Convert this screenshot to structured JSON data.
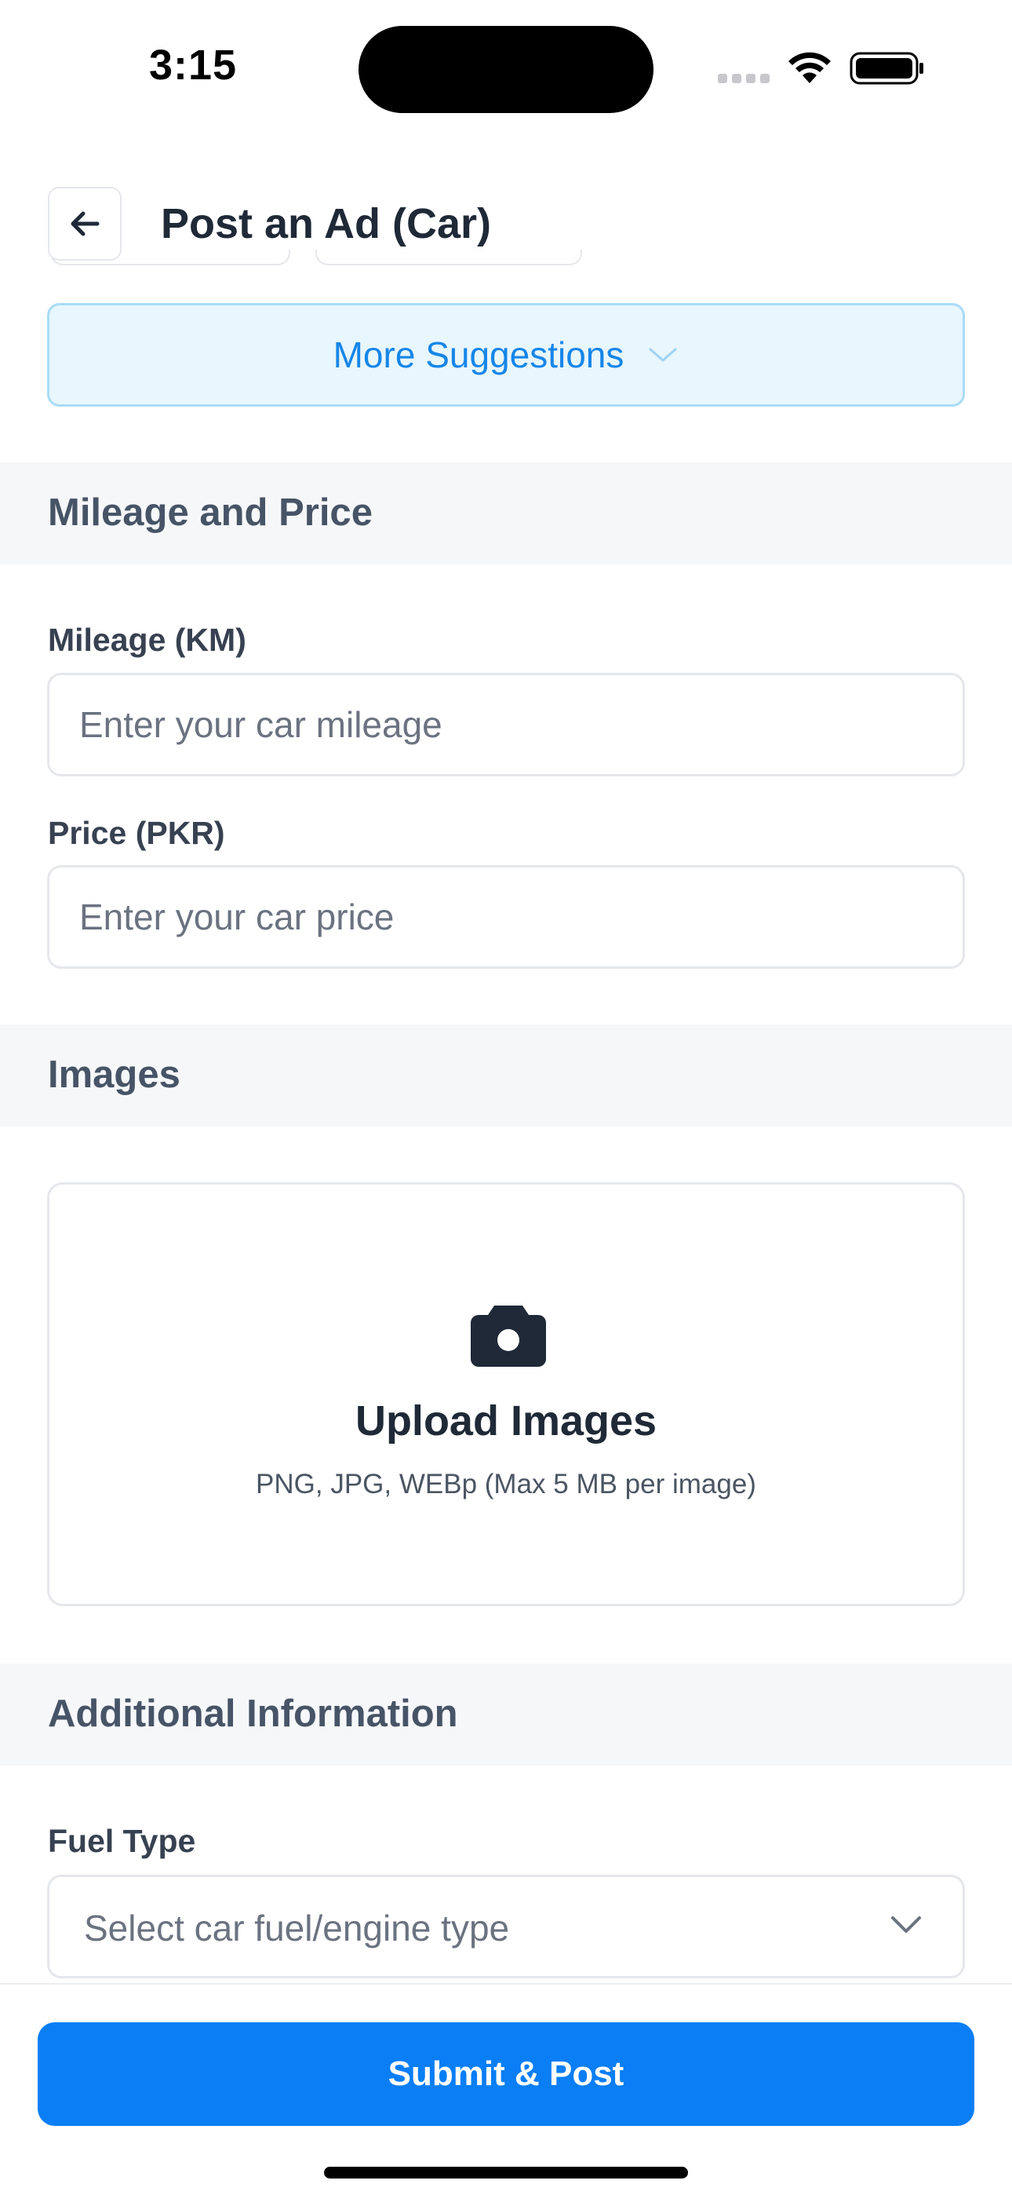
{
  "status_bar": {
    "time": "3:15"
  },
  "header": {
    "title": "Post an Ad (Car)",
    "back_icon": "arrow-left-icon"
  },
  "suggestions": {
    "more_label": "More Suggestions",
    "icon": "chevron-down-icon",
    "accent": "#1686e8"
  },
  "mileage_section": {
    "title": "Mileage and Price",
    "mileage_label": "Mileage (KM)",
    "mileage_placeholder": "Enter your car mileage",
    "price_label": "Price (PKR)",
    "price_placeholder": "Enter your car price"
  },
  "images_section": {
    "title": "Images",
    "upload_title": "Upload Images",
    "upload_hint": "PNG, JPG, WEBp (Max 5 MB per image)",
    "icon": "camera-icon"
  },
  "additional_section": {
    "title": "Additional Information",
    "fuel_label": "Fuel Type",
    "fuel_placeholder": "Select car fuel/engine type"
  },
  "footer": {
    "submit_label": "Submit & Post",
    "brand_color": "#0a7ef5"
  }
}
